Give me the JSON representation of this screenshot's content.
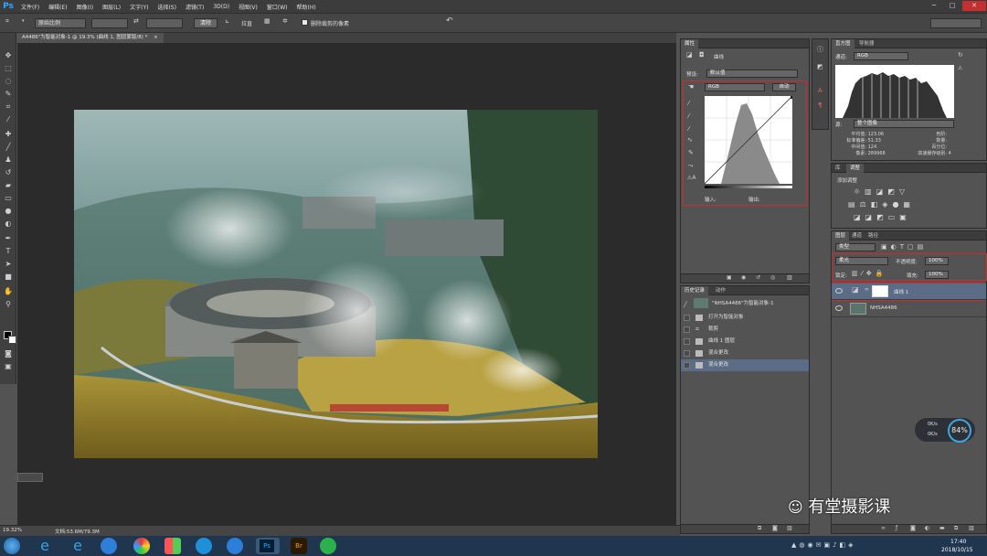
{
  "app": {
    "logo": "Ps"
  },
  "menu": [
    "文件(F)",
    "编辑(E)",
    "图像(I)",
    "图层(L)",
    "文字(Y)",
    "选择(S)",
    "滤镜(T)",
    "3D(D)",
    "视图(V)",
    "窗口(W)",
    "帮助(H)"
  ],
  "window_controls": {
    "minimize": "─",
    "maximize": "□",
    "close": "✕"
  },
  "options": {
    "ratio_select": "原始比例",
    "swap_icon": "⇄",
    "clear_button": "清除",
    "straighten": "拉直",
    "delete_cropped": "删除裁剪的像素",
    "reset_icon": "↶",
    "workspace_select": ""
  },
  "document": {
    "tab_label": "A4486\"为智能对象-1 @ 19.3% (曲线 1, 图层蒙版/8) *",
    "close": "×"
  },
  "status": {
    "zoom": "19.32%",
    "doc_size": "文档:53.6M/79.3M"
  },
  "properties_panel": {
    "tab": "属性",
    "title": "曲线",
    "preset_label": "预设:",
    "preset_value": "默认值",
    "channel": "RGB",
    "auto_button": "自动",
    "input_label": "输入:",
    "output_label": "输出:"
  },
  "histogram_panel": {
    "tabs": [
      "直方图",
      "导航器"
    ],
    "channel_label": "通道:",
    "channel": "RGB",
    "source_label": "源:",
    "source": "整个图像",
    "stats_left": [
      {
        "label": "平均值:",
        "value": "123.06"
      },
      {
        "label": "标准偏差:",
        "value": "51.33"
      },
      {
        "label": "中间值:",
        "value": "124"
      },
      {
        "label": "像素:",
        "value": "289968"
      }
    ],
    "stats_right": [
      {
        "label": "色阶:",
        "value": ""
      },
      {
        "label": "数量:",
        "value": ""
      },
      {
        "label": "百分位:",
        "value": ""
      },
      {
        "label": "高速缓存级别:",
        "value": "4"
      }
    ]
  },
  "adjustments_panel": {
    "tabs": [
      "库",
      "调整"
    ],
    "add_label": "添加调整"
  },
  "history_panel": {
    "tabs": [
      "历史记录",
      "动作"
    ],
    "snapshot": "\"NHSA4486\"为智能对象-1",
    "items": [
      "打开为智能对象",
      "裁剪",
      "曲线 1 图层",
      "混合更改",
      "混合更改"
    ]
  },
  "layers_panel": {
    "tabs": [
      "图层",
      "通道",
      "路径"
    ],
    "kind_filter": "类型",
    "blend_mode": "柔光",
    "opacity_label": "不透明度:",
    "opacity": "100%",
    "lock_label": "锁定:",
    "fill_label": "填充:",
    "fill": "100%",
    "layers": [
      {
        "name": "曲线 1",
        "selected": true
      },
      {
        "name": "NHSA4486",
        "selected": false
      }
    ]
  },
  "net_widget": {
    "up": "0K/s",
    "down": "0K/s",
    "percent": "84%"
  },
  "watermark": "有堂摄影课",
  "taskbar": {
    "time": "17:40",
    "date": "2018/10/15"
  },
  "colors": {
    "accent_red": "#d12a2a",
    "ps_blue": "#31a8ff",
    "selection": "#5b6d86"
  }
}
